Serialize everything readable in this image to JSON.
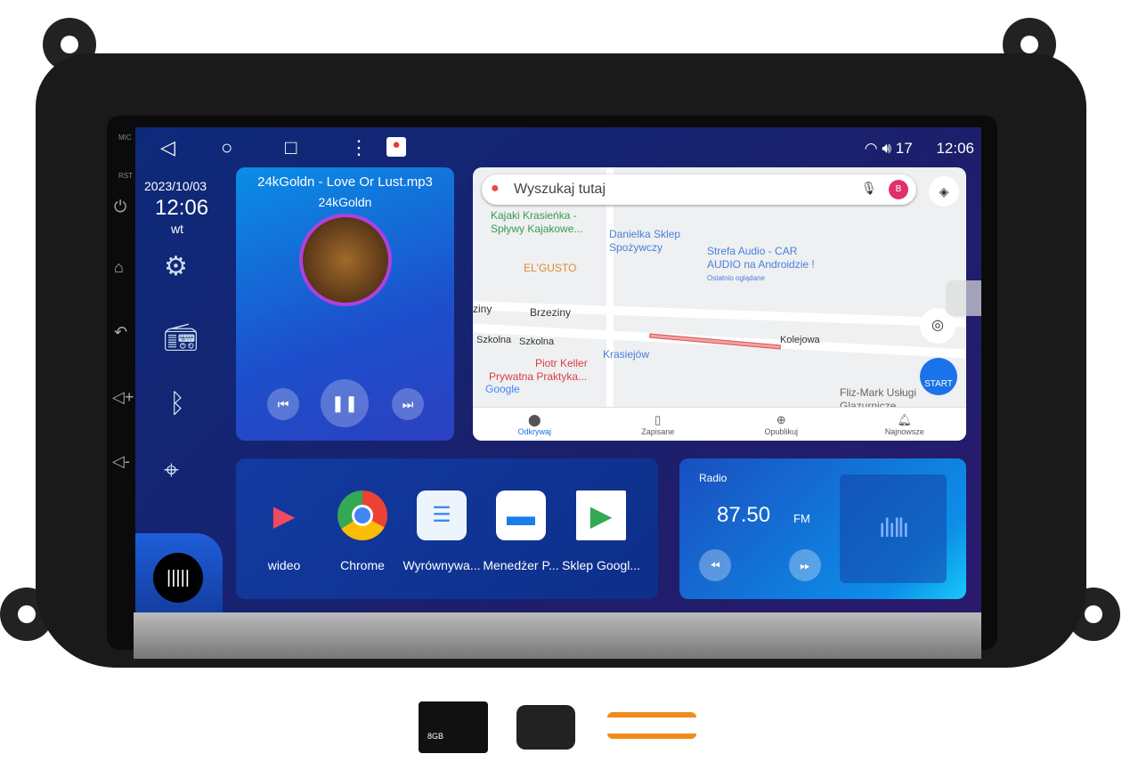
{
  "nav": {
    "back": "◁",
    "home": "○",
    "recents": "□",
    "menu": "⋮"
  },
  "status": {
    "volume": "17",
    "time": "12:06"
  },
  "hardware": {
    "mic": "MIC",
    "rst": "RST"
  },
  "clock": {
    "date": "2023/10/03",
    "time": "12:06",
    "weekday": "wt"
  },
  "music": {
    "title": "24kGoldn - Love Or Lust.mp3",
    "artist": "24kGoldn",
    "prev": "⏮",
    "pause": "❚❚",
    "next": "⏭"
  },
  "map": {
    "search_placeholder": "Wyszukaj tutaj",
    "avatar": "B",
    "start": "START",
    "labels": [
      "Kajaki Krasieńka -",
      "Spływy Kajakowe...",
      "Danielka Sklep",
      "Spożywczy",
      "Strefa Audio - CAR",
      "AUDIO na Androidzie !",
      "Ostatnio oglądane",
      "EL'GUSTO",
      "Brzeziny",
      "ziny",
      "Szkolna",
      "Szkolna",
      "Kolejowa",
      "Krasiejów",
      "Piotr Keller",
      "Prywatna Praktyka...",
      "Google",
      "Fliz-Mark Usługi",
      "Glazurnicze"
    ],
    "tabs": [
      "Odkrywaj",
      "Zapisane",
      "Opublikuj",
      "Najnowsze"
    ]
  },
  "apps": [
    {
      "label": "wideo"
    },
    {
      "label": "Chrome"
    },
    {
      "label": "Wyrównywa..."
    },
    {
      "label": "Menedżer P..."
    },
    {
      "label": "Sklep Googl..."
    }
  ],
  "radio": {
    "title": "Radio",
    "frequency": "87.50",
    "band": "FM"
  },
  "accessories": {
    "sd_card": "8GB"
  }
}
